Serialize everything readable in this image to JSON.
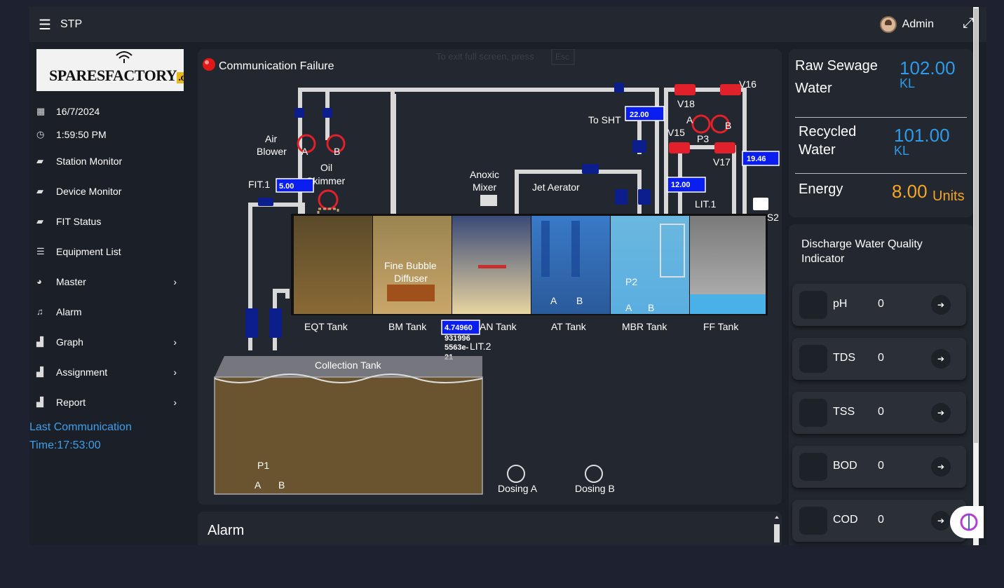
{
  "topbar": {
    "title": "STP",
    "user": "Admin"
  },
  "sidebar": {
    "date": "16/7/2024",
    "time": "1:59:50 PM",
    "items": [
      {
        "label": "Station Monitor"
      },
      {
        "label": "Device Monitor"
      },
      {
        "label": "FIT Status"
      },
      {
        "label": "Equipment List"
      },
      {
        "label": "Master"
      },
      {
        "label": "Alarm"
      },
      {
        "label": "Graph"
      },
      {
        "label": "Assignment"
      },
      {
        "label": "Report"
      }
    ],
    "last_comm_line1": "Last Communication",
    "last_comm_line2": "Time:17:53:00"
  },
  "logo": {
    "text_main": "SPARESFACTORY",
    "text_com": ".com"
  },
  "diagram": {
    "status": "Communication Failure",
    "fullscreen_hint": "To exit full screen, press",
    "fullscreen_key": "Esc",
    "labels": {
      "air_blower_1": "Air",
      "air_blower_2": "Blower",
      "blower_a": "A",
      "blower_b": "B",
      "oil_1": "Oil",
      "oil_2": "Skimmer",
      "fit1": "FIT.1",
      "fit1_value": "5.00",
      "anoxic_1": "Anoxic",
      "anoxic_2": "Mixer",
      "jet_aerator": "Jet Aerator",
      "to_sht": "To SHT",
      "sht_value": "22.00",
      "v15": "V15",
      "v16": "V16",
      "v17": "V17",
      "v18": "V18",
      "p3": "P3",
      "p3_a": "A",
      "p3_b": "B",
      "v_value": "19.46",
      "lit1": "LIT.1",
      "lit1_value": "12.00",
      "ls2": "LS2",
      "fine_1": "Fine Bubble",
      "fine_2": "Diffuser",
      "at_a": "A",
      "at_b": "B",
      "p2": "P2",
      "p2_a": "A",
      "p2_b": "B",
      "eqt": "EQT Tank",
      "bm": "BM Tank",
      "an": "AN Tank",
      "at": "AT Tank",
      "mbr": "MBR Tank",
      "ff": "FF Tank",
      "lit2": "LIT.2",
      "lit2_value": "4.74960",
      "lit2_overflow_1": "931996",
      "lit2_overflow_2": "5563e-",
      "lit2_overflow_3": "21",
      "collection": "Collection Tank",
      "p1": "P1",
      "p1_a": "A",
      "p1_b": "B",
      "dosing_a": "Dosing A",
      "dosing_b": "Dosing B"
    }
  },
  "alarm": {
    "title": "Alarm"
  },
  "summary": {
    "raw_label_1": "Raw Sewage",
    "raw_label_2": "Water",
    "raw_value": "102.00",
    "raw_unit": "KL",
    "recycled_label_1": "Recycled",
    "recycled_label_2": "Water",
    "recycled_value": "101.00",
    "recycled_unit": "KL",
    "energy_label": "Energy",
    "energy_value": "8.00",
    "energy_unit": "Units"
  },
  "quality": {
    "title_1": "Discharge Water Quality",
    "title_2": "Indicator",
    "items": [
      {
        "name": "pH",
        "value": "0"
      },
      {
        "name": "TDS",
        "value": "0"
      },
      {
        "name": "TSS",
        "value": "0"
      },
      {
        "name": "BOD",
        "value": "0"
      },
      {
        "name": "COD",
        "value": "0"
      }
    ]
  },
  "colors": {
    "accent_blue": "#2e9ae8",
    "energy_orange": "#f5a623",
    "value_box": "#0a1ef0",
    "valve_red": "#e0202a",
    "valve_navy": "#0b1e8c"
  },
  "icons": [
    "hamburger-icon",
    "expand-icon",
    "calendar-icon",
    "clock-icon",
    "briefcase-icon",
    "list-icon",
    "pie-icon",
    "bell-icon",
    "bar-chart-icon",
    "chevron-right-icon",
    "arrow-right-icon"
  ]
}
